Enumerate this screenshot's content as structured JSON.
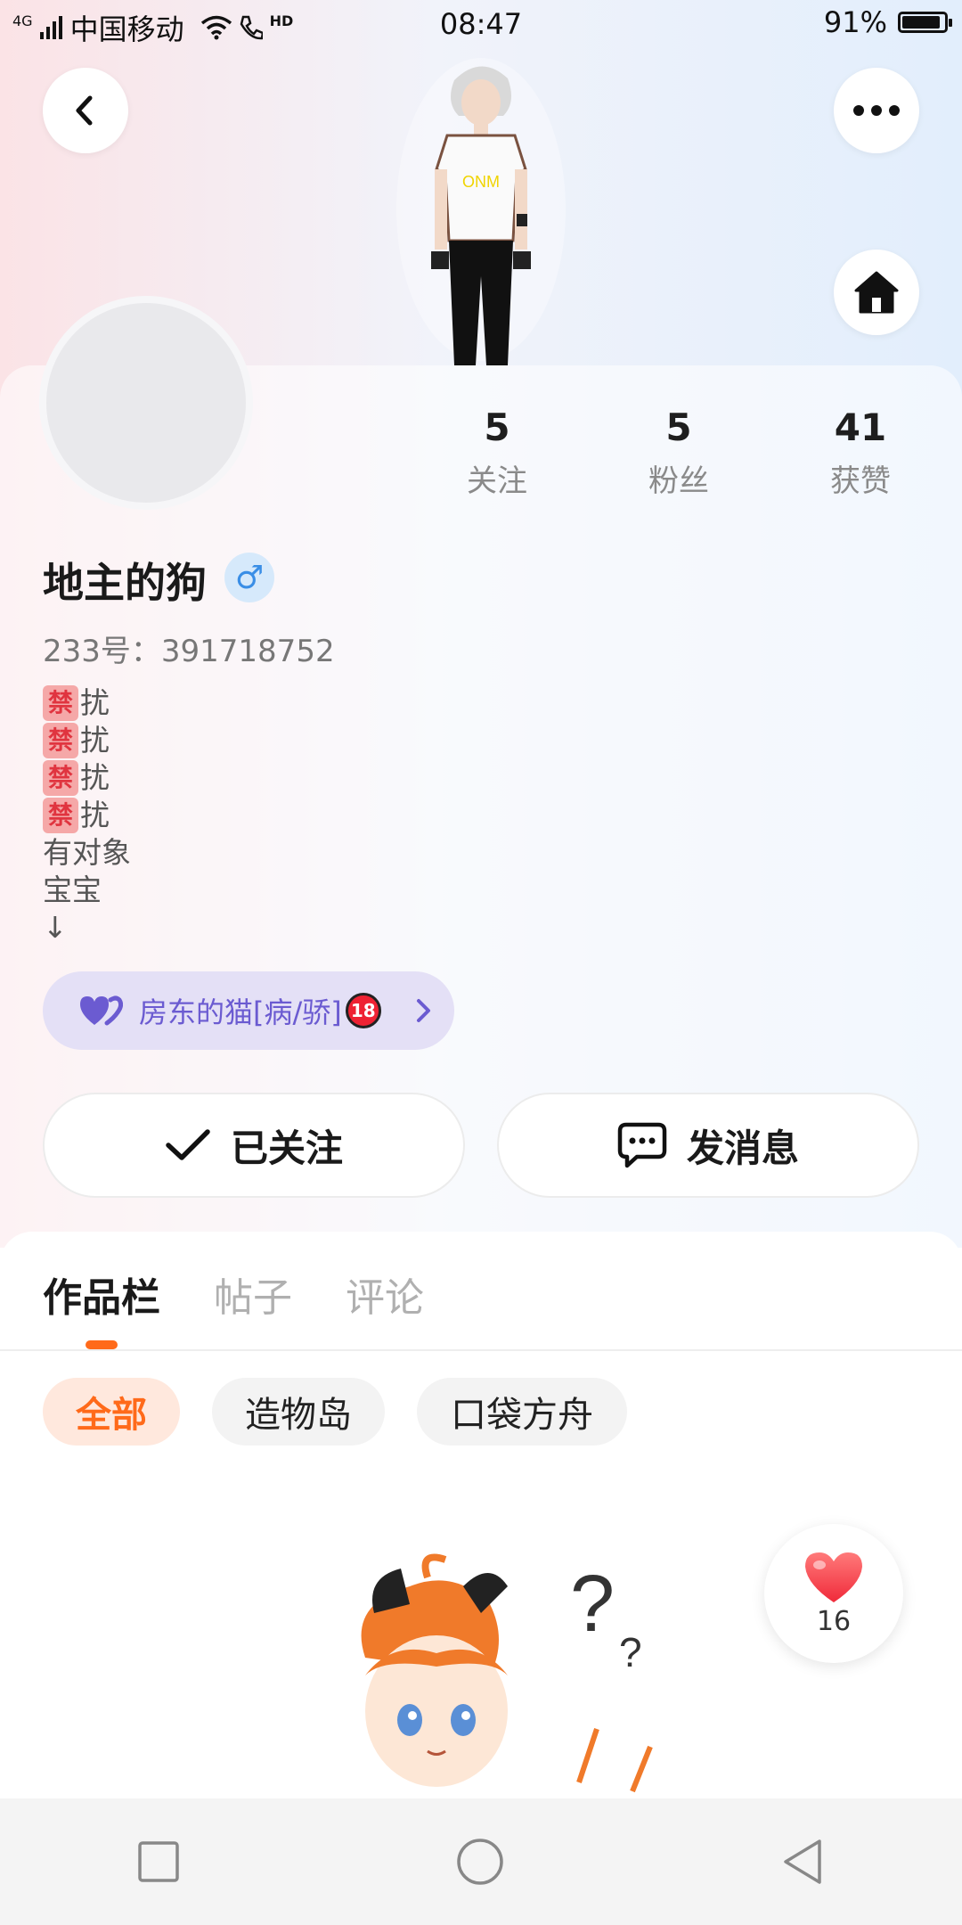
{
  "status_bar": {
    "network": "4G",
    "carrier": "中国移动",
    "hd": "HD",
    "time": "08:47",
    "battery": "91%",
    "battery_level": 0.91
  },
  "profile": {
    "name": "地主的狗",
    "gender_symbol": "♂",
    "uid": "233号：391718752",
    "stats": [
      {
        "value": "5",
        "label": "关注"
      },
      {
        "value": "5",
        "label": "粉丝"
      },
      {
        "value": "41",
        "label": "获赞"
      }
    ],
    "bio": {
      "ban_char": "禁",
      "ban_suffix": "扰",
      "lines": [
        "有对象",
        "宝宝",
        "↓"
      ]
    },
    "partner": {
      "name": "房东的猫[病/骄]",
      "age_badge": "18"
    }
  },
  "actions": {
    "follow": "已关注",
    "message": "发消息"
  },
  "tabs": [
    "作品栏",
    "帖子",
    "评论"
  ],
  "filters": [
    "全部",
    "造物岛",
    "口袋方舟"
  ],
  "like_button": {
    "count": "16"
  },
  "colors": {
    "accent": "#ff6a1a",
    "partner_chip": "#e4e0f6",
    "partner_text": "#6b5bd1"
  }
}
